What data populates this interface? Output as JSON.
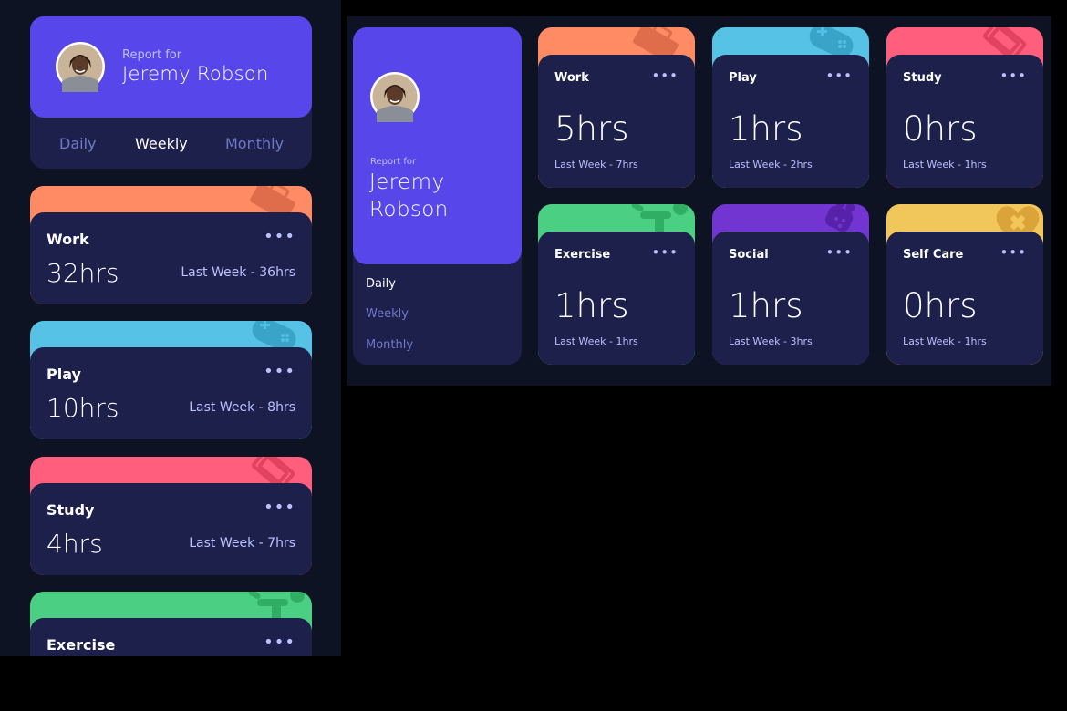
{
  "colors": {
    "page_bg": "#0e1323",
    "card_bg": "#1c204b",
    "profile_bg": "#5747ea",
    "muted_text": "#bbc0ff",
    "tab_inactive": "#7078c9",
    "work": "#ff8b64",
    "play": "#55c2e6",
    "study": "#ff5e7d",
    "exercise": "#4bcf82",
    "social": "#7335d2",
    "self_care": "#f1c75b"
  },
  "mobile": {
    "report_label": "Report for",
    "user_name": "Jeremy Robson",
    "tabs": [
      "Daily",
      "Weekly",
      "Monthly"
    ],
    "active_tab": "Weekly",
    "cards": [
      {
        "title": "Work",
        "hours": "32hrs",
        "last": "Last Week - 36hrs",
        "icon": "briefcase-icon"
      },
      {
        "title": "Play",
        "hours": "10hrs",
        "last": "Last Week - 8hrs",
        "icon": "gamepad-icon"
      },
      {
        "title": "Study",
        "hours": "4hrs",
        "last": "Last Week - 7hrs",
        "icon": "book-icon"
      },
      {
        "title": "Exercise",
        "icon": "runner-icon"
      }
    ],
    "dots": "•••"
  },
  "desktop": {
    "report_label": "Report for",
    "user_first": "Jeremy",
    "user_last": "Robson",
    "tabs": [
      "Daily",
      "Weekly",
      "Monthly"
    ],
    "active_tab": "Daily",
    "cards": [
      {
        "title": "Work",
        "hours": "5hrs",
        "last": "Last Week - 7hrs",
        "icon": "briefcase-icon"
      },
      {
        "title": "Play",
        "hours": "1hrs",
        "last": "Last Week - 2hrs",
        "icon": "gamepad-icon"
      },
      {
        "title": "Study",
        "hours": "0hrs",
        "last": "Last Week - 1hrs",
        "icon": "book-icon"
      },
      {
        "title": "Exercise",
        "hours": "1hrs",
        "last": "Last Week - 1hrs",
        "icon": "runner-icon"
      },
      {
        "title": "Social",
        "hours": "1hrs",
        "last": "Last Week - 3hrs",
        "icon": "social-icon"
      },
      {
        "title": "Self Care",
        "hours": "0hrs",
        "last": "Last Week - 1hrs",
        "icon": "heart-icon"
      }
    ],
    "dots": "•••"
  }
}
